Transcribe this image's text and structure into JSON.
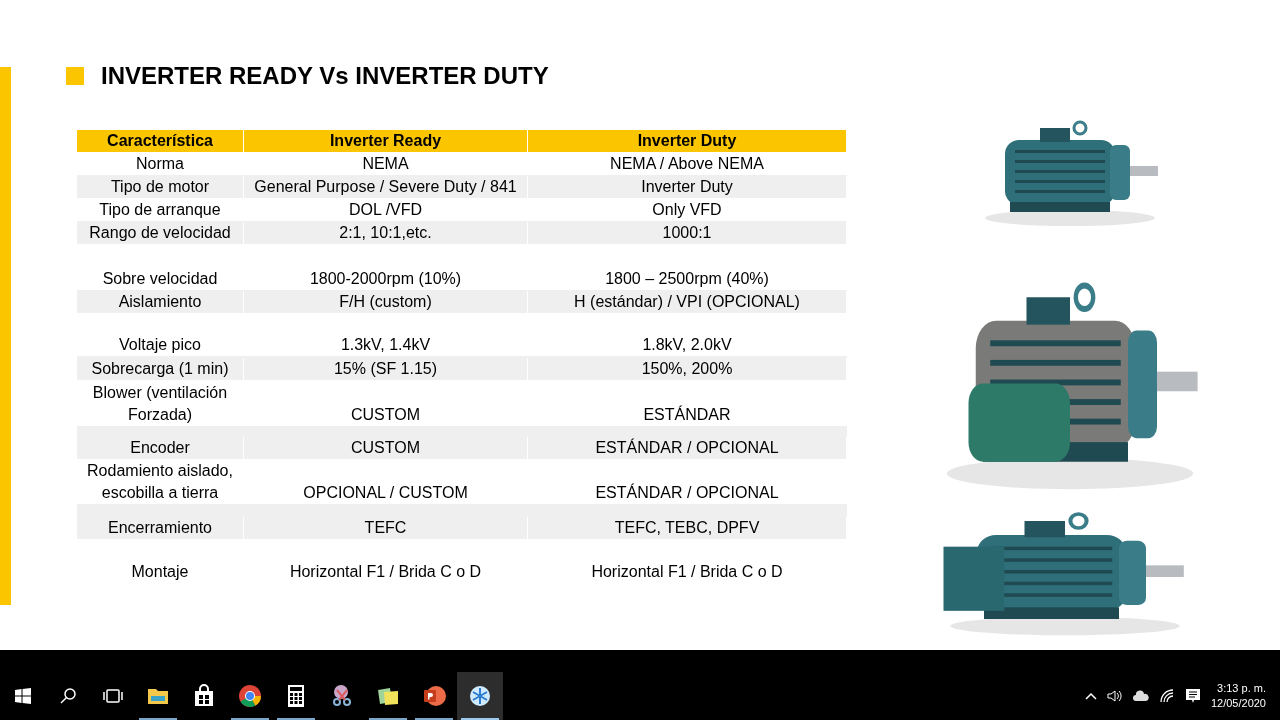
{
  "slide": {
    "title": "INVERTER READY Vs INVERTER DUTY",
    "table": {
      "columns": [
        "Característica",
        "Inverter Ready",
        "Inverter Duty"
      ],
      "rows": [
        {
          "cells": [
            "Norma",
            "NEMA",
            "NEMA / Above NEMA"
          ]
        },
        {
          "cells": [
            "Tipo de motor",
            "General Purpose / Severe Duty / 841",
            "Inverter Duty"
          ]
        },
        {
          "cells": [
            "Tipo de arranque",
            "DOL /VFD",
            "Only VFD"
          ]
        },
        {
          "cells": [
            "Rango de velocidad",
            "2:1, 10:1,etc.",
            "1000:1"
          ]
        },
        {
          "cells": [
            "Sobre velocidad",
            "1800-2000rpm (10%)",
            "1800 – 2500rpm (40%)"
          ]
        },
        {
          "cells": [
            "Aislamiento",
            "F/H (custom)",
            "H (estándar) / VPI (OPCIONAL)"
          ]
        },
        {
          "cells": [
            "Voltaje pico",
            "1.3kV, 1.4kV",
            "1.8kV, 2.0kV"
          ]
        },
        {
          "cells": [
            "Sobrecarga (1 min)",
            "15% (SF 1.15)",
            "150%, 200%"
          ]
        },
        {
          "cells": [
            "Blower (ventilación Forzada)",
            "CUSTOM",
            "ESTÁNDAR"
          ]
        },
        {
          "cells": [
            "Encoder",
            "CUSTOM",
            "ESTÁNDAR / OPCIONAL"
          ]
        },
        {
          "cells": [
            "Rodamiento aislado, escobilla a tierra",
            "OPCIONAL / CUSTOM",
            "ESTÁNDAR / OPCIONAL"
          ]
        },
        {
          "cells": [
            "Encerramiento",
            "TEFC",
            "TEFC, TEBC, DPFV"
          ]
        },
        {
          "cells": [
            "Montaje",
            "Horizontal F1 / Brida C o D",
            "Horizontal F1 / Brida C o D"
          ]
        }
      ]
    }
  },
  "taskbar": {
    "apps": [
      {
        "kind": "explorer",
        "running": true,
        "selected": false
      },
      {
        "kind": "store",
        "running": false,
        "selected": false
      },
      {
        "kind": "chrome",
        "running": true,
        "selected": false
      },
      {
        "kind": "calculator",
        "running": true,
        "selected": false
      },
      {
        "kind": "snipping",
        "running": false,
        "selected": false
      },
      {
        "kind": "notes",
        "running": true,
        "selected": false
      },
      {
        "kind": "powerpoint",
        "running": true,
        "selected": false
      },
      {
        "kind": "snowflake",
        "running": true,
        "selected": true
      }
    ],
    "time": "3:13 p. m.",
    "date": "12/05/2020"
  }
}
